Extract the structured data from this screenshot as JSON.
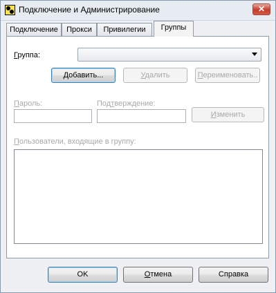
{
  "window": {
    "title": "Подключение и Администрирование",
    "close_label": "✕"
  },
  "tabs": [
    {
      "label": "Подключение"
    },
    {
      "label": "Прокси"
    },
    {
      "label": "Привилегии"
    },
    {
      "label": "Группы",
      "active": true
    }
  ],
  "group": {
    "label_first": "Г",
    "label_rest": "руппа:",
    "selected": ""
  },
  "buttons": {
    "add_u": "Д",
    "add_rest": "обавить...",
    "delete_u": "У",
    "delete_rest": "далить",
    "rename_u": "П",
    "rename_rest": "ереименовать..",
    "change_u": "И",
    "change_rest": "зменить"
  },
  "password": {
    "label_u": "П",
    "label_rest": "ароль:",
    "value": ""
  },
  "confirm": {
    "label_pre": "Под",
    "label_u": "т",
    "label_rest": "верждение:",
    "value": ""
  },
  "users": {
    "label_u": "П",
    "label_rest": "ользователи, входящие в группу:",
    "items": []
  },
  "footer": {
    "ok": "OK",
    "cancel_u": "О",
    "cancel_rest": "тмена",
    "help": "Справка"
  }
}
